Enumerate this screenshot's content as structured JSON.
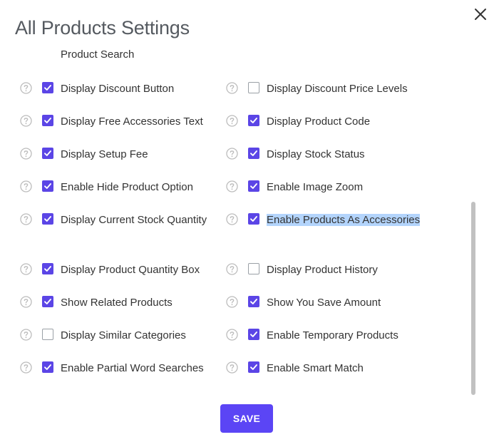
{
  "dialog": {
    "title": "All Products Settings",
    "section_partial": "Product Search",
    "save_label": "SAVE"
  },
  "left": [
    {
      "label": "Display Discount Button",
      "checked": true
    },
    {
      "label": "Display Free Accessories Text",
      "checked": true
    },
    {
      "label": "Display Setup Fee",
      "checked": true
    },
    {
      "label": "Enable Hide Product Option",
      "checked": true
    },
    {
      "label": "Display Current Stock Quantity",
      "checked": true
    },
    {
      "label": "Display Product Quantity Box",
      "checked": true
    },
    {
      "label": "Show Related Products",
      "checked": true
    },
    {
      "label": "Display Similar Categories",
      "checked": false
    },
    {
      "label": "Enable Partial Word Searches",
      "checked": true
    }
  ],
  "right": [
    {
      "label": "Display Discount Price Levels",
      "checked": false
    },
    {
      "label": "Display Product Code",
      "checked": true
    },
    {
      "label": "Display Stock Status",
      "checked": true
    },
    {
      "label": "Enable Image Zoom",
      "checked": true
    },
    {
      "label": "Enable Products As Accessories",
      "checked": true,
      "highlighted": true
    },
    {
      "label": "Display Product History",
      "checked": false
    },
    {
      "label": "Show You Save Amount",
      "checked": true
    },
    {
      "label": "Enable Temporary Products",
      "checked": true
    },
    {
      "label": "Enable Smart Match",
      "checked": true
    }
  ],
  "colors": {
    "accent": "#5b45e6",
    "save_button": "#5b45f5",
    "selection_highlight": "#b3d4fc"
  },
  "icons": {
    "help": "question-circle-icon",
    "close": "close-icon",
    "check": "checkmark-icon"
  }
}
